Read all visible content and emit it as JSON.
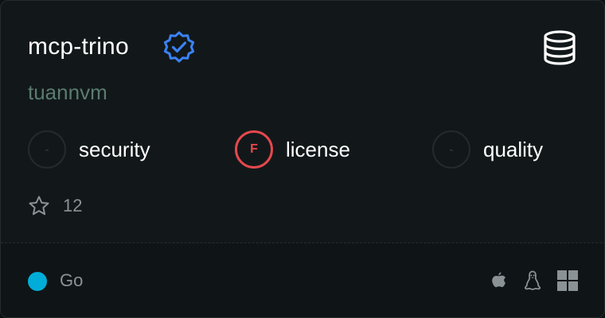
{
  "server": {
    "name": "mcp-trino",
    "author": "tuannvm",
    "verified_icon": "verified-badge-icon",
    "category_icon": "database-icon"
  },
  "metrics": [
    {
      "label": "security",
      "grade": "-",
      "status": "unrated"
    },
    {
      "label": "license",
      "grade": "F",
      "status": "fail"
    },
    {
      "label": "quality",
      "grade": "-",
      "status": "unrated"
    }
  ],
  "stars": {
    "icon": "star-icon",
    "count": "12"
  },
  "footer": {
    "language": "Go",
    "language_color": "#00add8",
    "platforms": [
      "apple-icon",
      "linux-icon",
      "windows-icon"
    ]
  },
  "colors": {
    "background": "#12181a",
    "author": "#5b7b70",
    "verified": "#3b82f6",
    "fail": "#e5484d"
  }
}
